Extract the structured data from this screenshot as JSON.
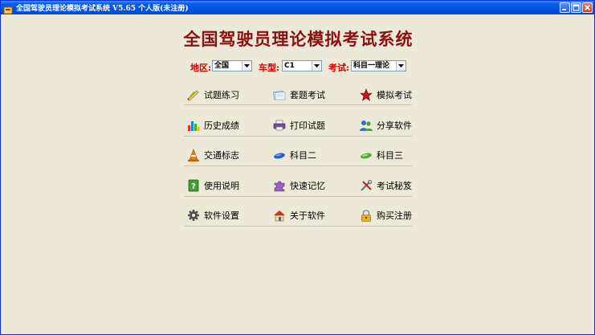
{
  "window": {
    "title": "全国驾驶员理论模拟考试系统  V5.65 个人版(未注册)"
  },
  "main_title": "全国驾驶员理论模拟考试系统",
  "selectors": {
    "region": {
      "label": "地区:",
      "value": "全国"
    },
    "vehicle": {
      "label": "车型:",
      "value": "C1"
    },
    "exam": {
      "label": "考试:",
      "value": "科目一理论"
    }
  },
  "menu": [
    {
      "label": "试题练习",
      "icon": "pencil-icon"
    },
    {
      "label": "套题考试",
      "icon": "papers-icon"
    },
    {
      "label": "模拟考试",
      "icon": "star-icon"
    },
    {
      "label": "历史成绩",
      "icon": "bar-chart-icon"
    },
    {
      "label": "打印试题",
      "icon": "printer-icon"
    },
    {
      "label": "分享软件",
      "icon": "users-icon"
    },
    {
      "label": "交通标志",
      "icon": "traffic-cone-icon"
    },
    {
      "label": "科目二",
      "icon": "blue-pill-icon"
    },
    {
      "label": "科目三",
      "icon": "green-pill-icon"
    },
    {
      "label": "使用说明",
      "icon": "help-book-icon"
    },
    {
      "label": "快速记忆",
      "icon": "puzzle-icon"
    },
    {
      "label": "考试秘笈",
      "icon": "tools-icon"
    },
    {
      "label": "软件设置",
      "icon": "gear-icon"
    },
    {
      "label": "关于软件",
      "icon": "house-icon"
    },
    {
      "label": "购买注册",
      "icon": "lock-icon"
    }
  ],
  "colors": {
    "title_bar": "#0055e5",
    "main_title": "#8b1010",
    "selector_label": "#d00000",
    "background": "#ece9d8"
  }
}
